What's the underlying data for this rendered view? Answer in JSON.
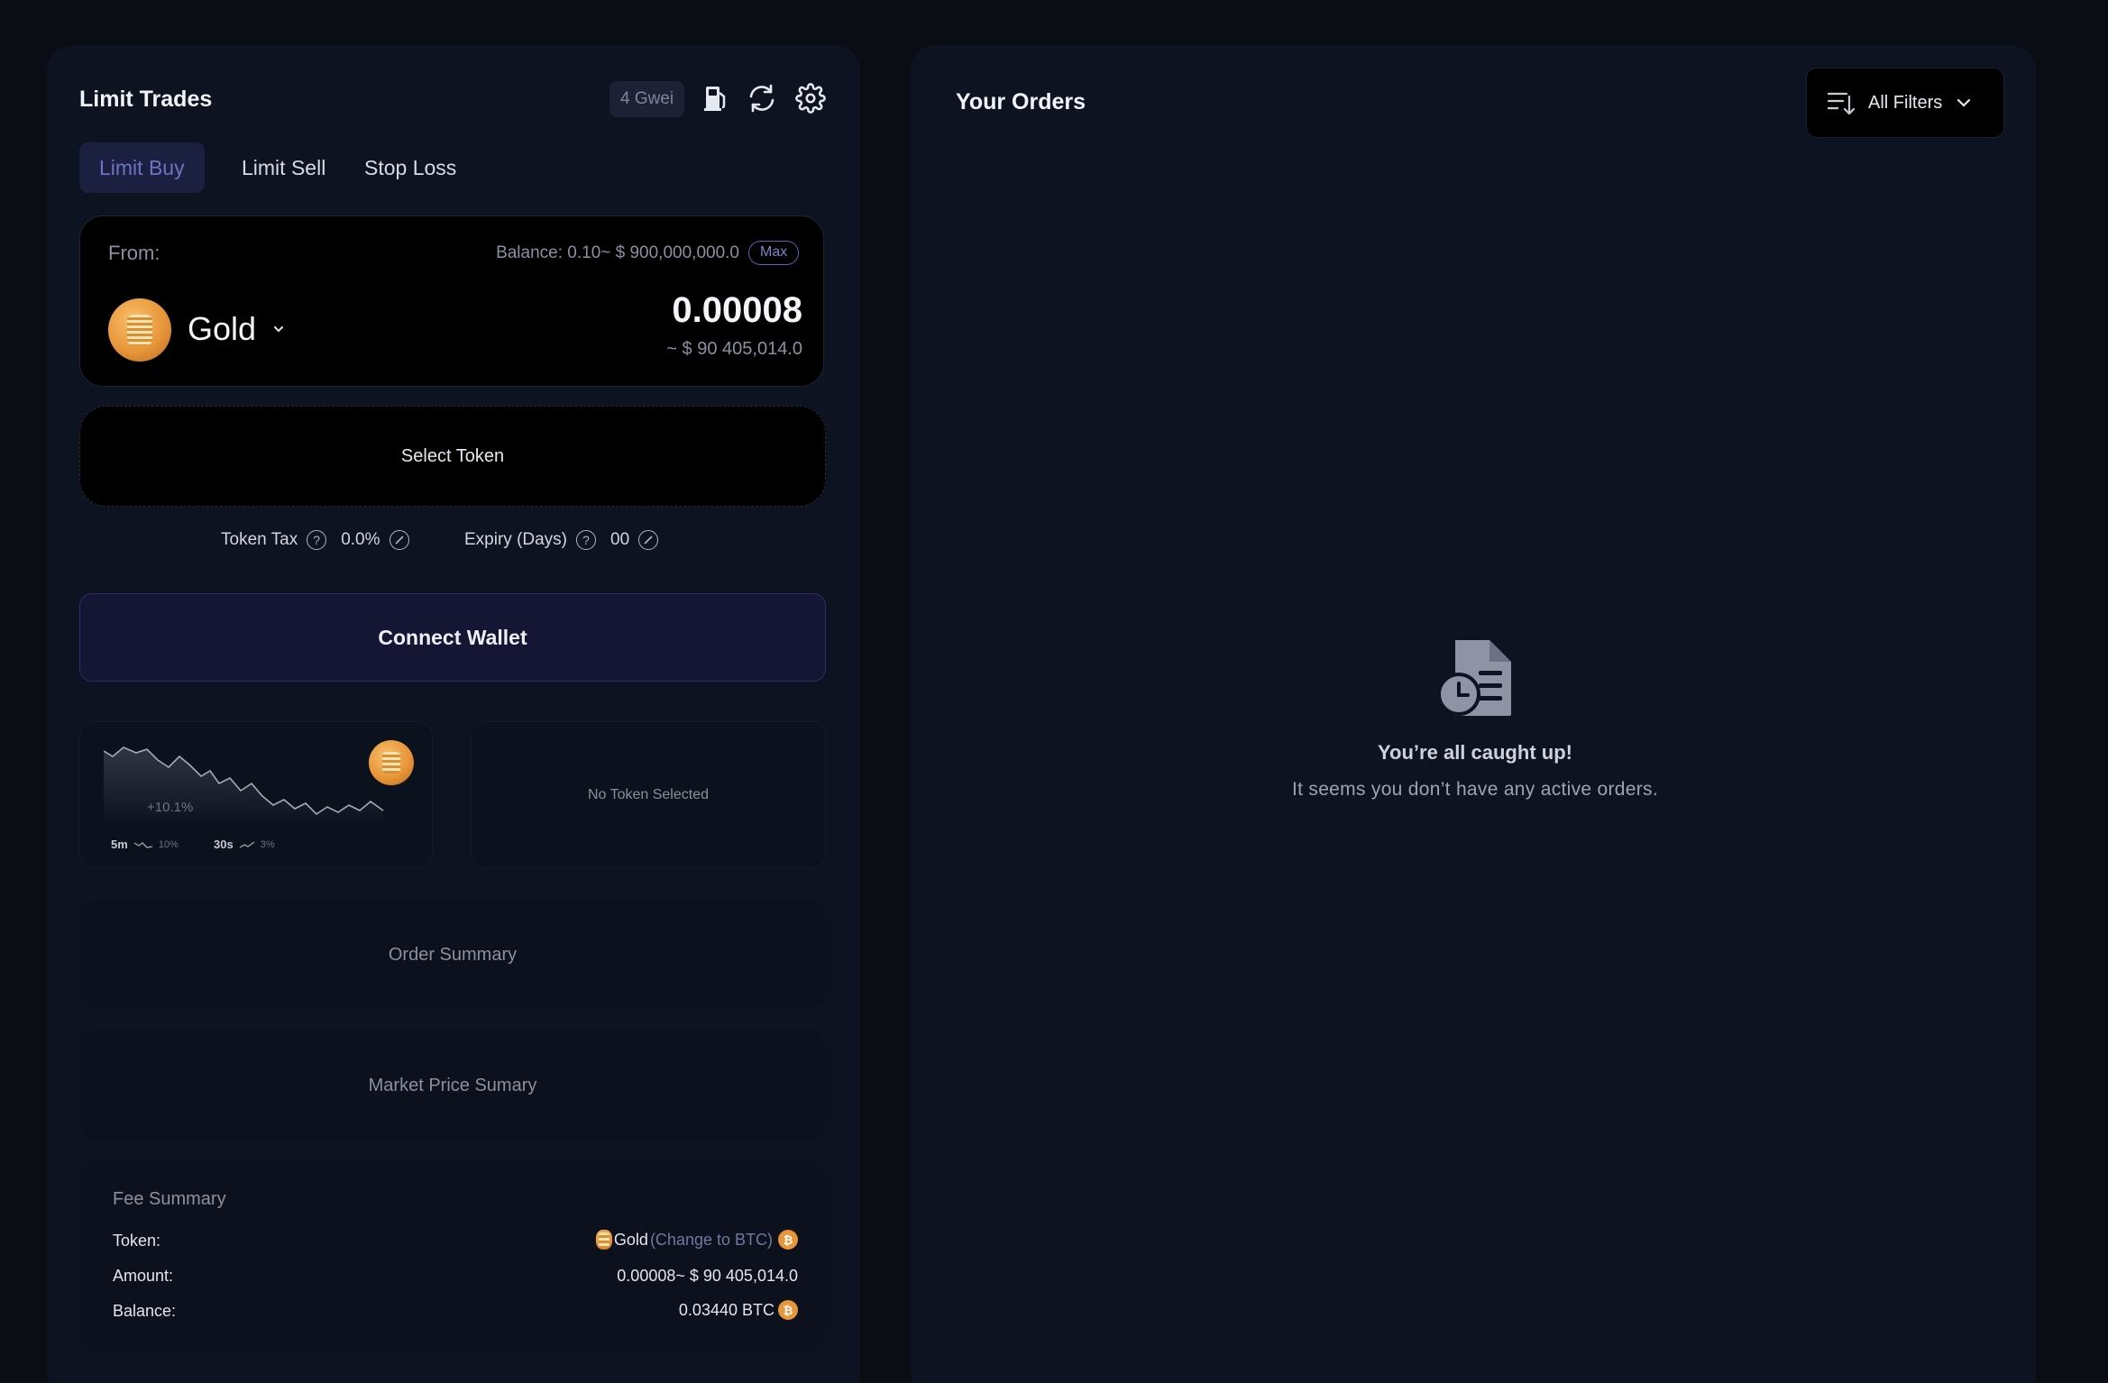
{
  "left": {
    "title": "Limit Trades",
    "gas_badge": "4 Gwei",
    "icons": [
      "gas-pump-icon",
      "refresh-icon",
      "gear-icon"
    ],
    "tabs": [
      {
        "label": "Limit Buy",
        "active": true
      },
      {
        "label": "Limit Sell",
        "active": false
      },
      {
        "label": "Stop Loss",
        "active": false
      }
    ],
    "from": {
      "label": "From:",
      "balance": "Balance: 0.10~ $ 900,000,000.0",
      "max_label": "Max",
      "token_name": "Gold",
      "amount": "0.00008",
      "amount_usd": "~ $ 90 405,014.0"
    },
    "select_token_label": "Select Token",
    "token_tax": {
      "label": "Token Tax",
      "value": "0.0%"
    },
    "expiry": {
      "label": "Expiry (Days)",
      "value": "00"
    },
    "connect_wallet_label": "Connect Wallet",
    "mini_chart": {
      "change": "+10.1%",
      "timeframes": [
        {
          "label": "5m",
          "value": "10%"
        },
        {
          "label": "30s",
          "value": "3%"
        }
      ]
    },
    "no_token_label": "No Token Selected",
    "order_summary_label": "Order Summary",
    "market_summary_label": "Market Price Sumary",
    "fee_summary": {
      "title": "Fee Summary",
      "token_label": "Token:",
      "token_value": "Gold",
      "token_change": "(Change to BTC)",
      "amount_label": "Amount:",
      "amount_value": "0.00008~ $ 90 405,014.0",
      "balance_label": "Balance:",
      "balance_value": "0.03440 BTC"
    }
  },
  "right": {
    "title": "Your Orders",
    "filters_label": "All Filters",
    "empty_title": "You’re all caught up!",
    "empty_subtitle": "It seems you don’t have any active orders."
  },
  "colors": {
    "background": "#0a0d14",
    "panel": "#0e1322",
    "accent": "#6b74c4",
    "gold": "#e8963a"
  }
}
